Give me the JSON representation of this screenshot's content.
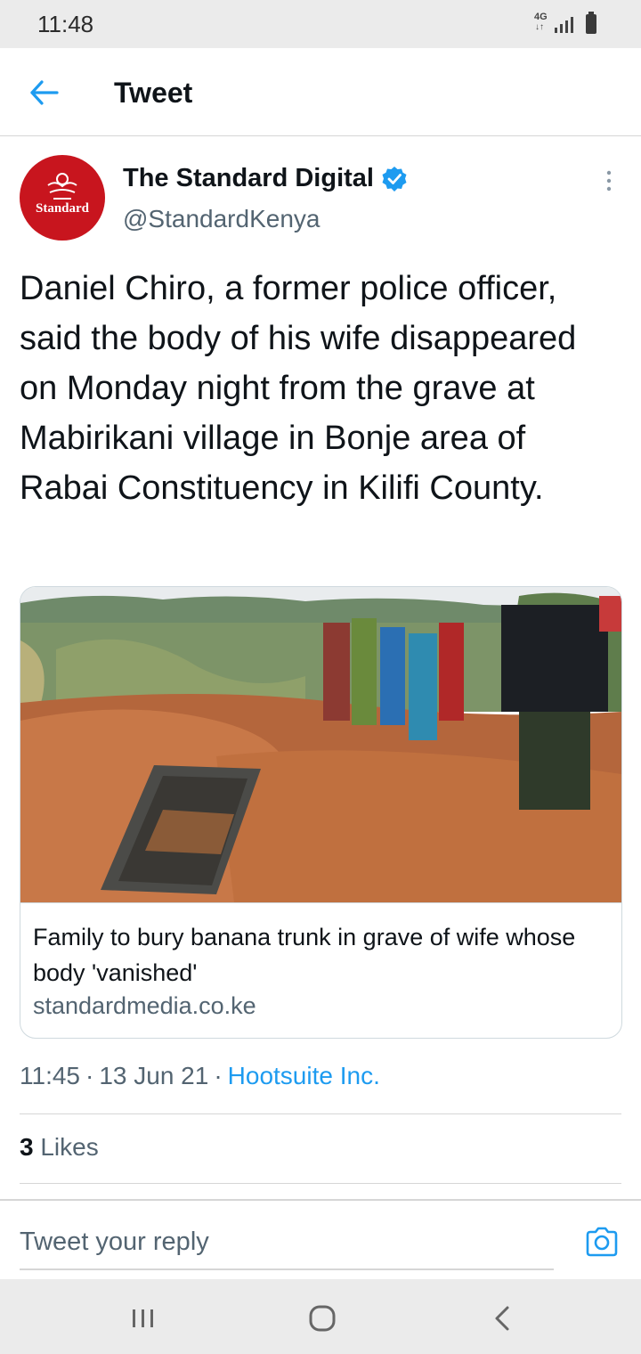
{
  "status_bar": {
    "time": "11:48",
    "network_label": "4G",
    "network_arrows": "↓↑"
  },
  "header": {
    "title": "Tweet"
  },
  "tweet": {
    "author": {
      "display_name": "The Standard Digital",
      "handle": "@StandardKenya",
      "avatar_text": "Standard",
      "verified": true
    },
    "text": "Daniel Chiro, a former police officer, said the body of his wife disappeared on Monday night from the grave at Mabirikani village in Bonje area of Rabai Constituency in Kilifi County.",
    "link_card": {
      "title": "Family to bury banana trunk in grave of wife whose body 'vanished'",
      "domain": "standardmedia.co.ke"
    },
    "time": "11:45",
    "date": "13 Jun 21",
    "separator": "·",
    "source": "Hootsuite Inc.",
    "likes_count": "3",
    "likes_label": "Likes"
  },
  "reply": {
    "placeholder": "Tweet your reply"
  },
  "colors": {
    "accent": "#1d9bf0",
    "avatar_bg": "#c8151e",
    "secondary_text": "#536471",
    "system_bar": "#ebebeb"
  }
}
